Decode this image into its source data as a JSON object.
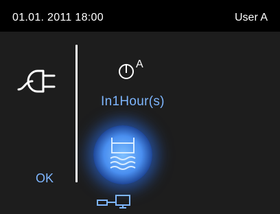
{
  "status_bar": {
    "datetime": "01.01. 2011 18:00",
    "user": "User A"
  },
  "left_panel": {
    "icon": "power-plug-icon",
    "ok_label": "OK"
  },
  "right_panel": {
    "timer_icon": "timer-icon",
    "timer_superscript": "A",
    "timer_text": "In1Hour(s)",
    "bath_button_icon": "bath-water-icon",
    "network_icon": "network-monitor-icon"
  },
  "colors": {
    "accent_text": "#7eb6ff",
    "glow": "#4a8ff0",
    "panel_background": "#1d1d1d"
  }
}
